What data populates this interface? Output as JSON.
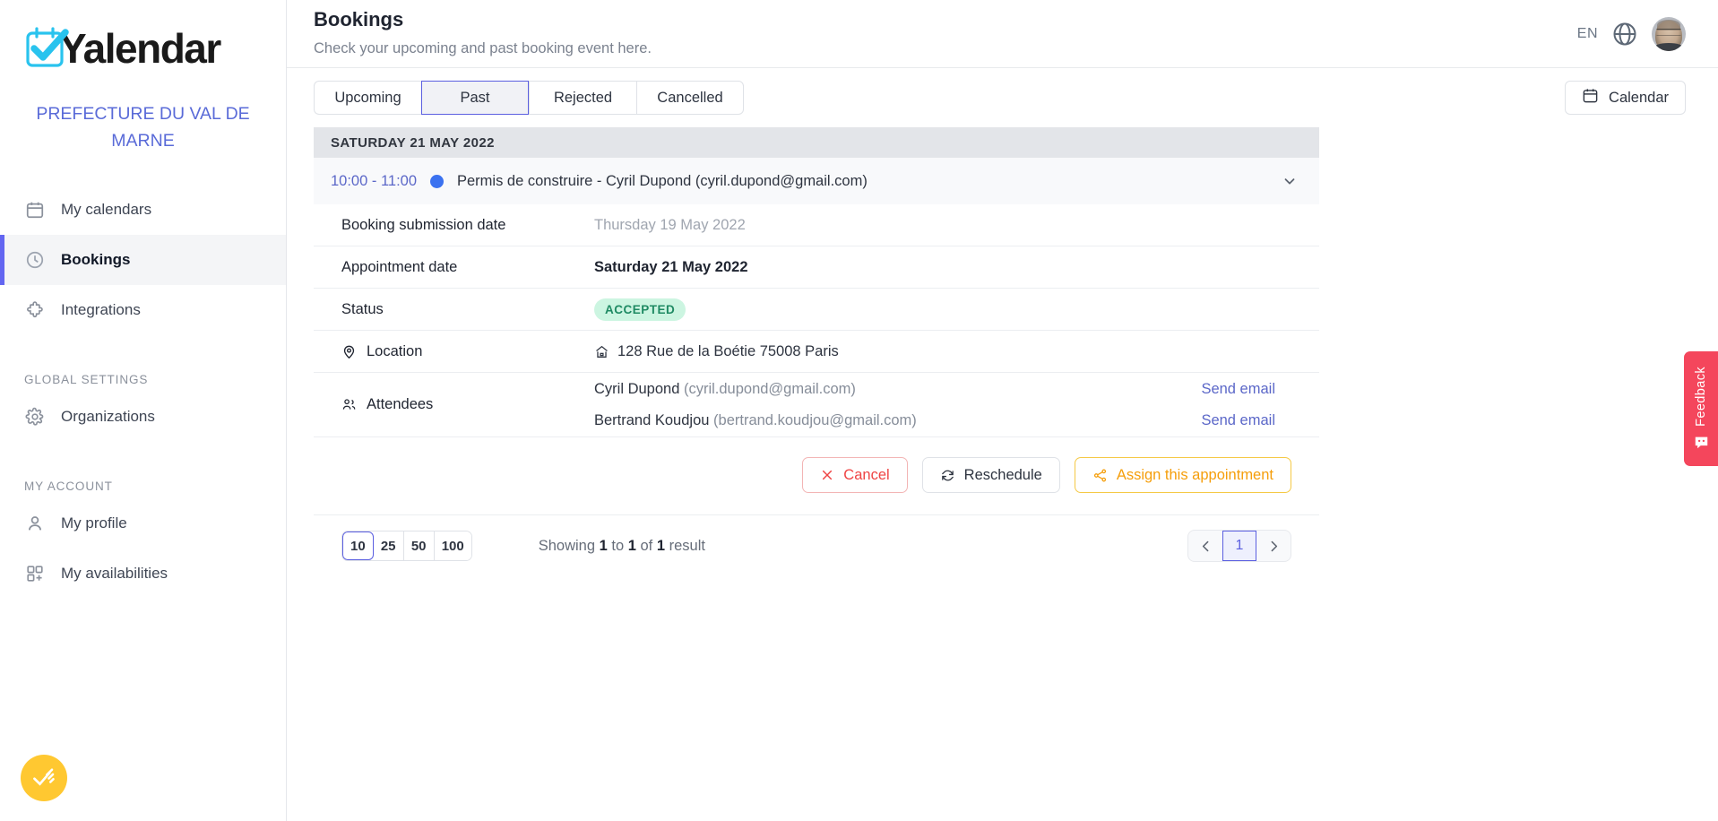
{
  "brand": {
    "logo_text": "Yalendar",
    "logo_icon": "calendar-check-icon"
  },
  "organization": {
    "name": "PREFECTURE DU VAL DE MARNE"
  },
  "sidebar": {
    "items": [
      {
        "label": "My calendars",
        "icon": "calendar-icon",
        "active": false
      },
      {
        "label": "Bookings",
        "icon": "clock-icon",
        "active": true
      },
      {
        "label": "Integrations",
        "icon": "puzzle-icon",
        "active": false
      }
    ],
    "global_settings_label": "GLOBAL SETTINGS",
    "global_settings_items": [
      {
        "label": "Organizations",
        "icon": "gear-icon"
      }
    ],
    "my_account_label": "MY ACCOUNT",
    "my_account_items": [
      {
        "label": "My profile",
        "icon": "user-icon"
      },
      {
        "label": "My availabilities",
        "icon": "grid-plus-icon"
      }
    ]
  },
  "header": {
    "title": "Bookings",
    "subtitle": "Check your upcoming and past booking event here.",
    "language": "EN",
    "globe_icon": "globe-icon",
    "avatar": "user-avatar"
  },
  "tabs": [
    {
      "label": "Upcoming",
      "active": false
    },
    {
      "label": "Past",
      "active": true
    },
    {
      "label": "Rejected",
      "active": false
    },
    {
      "label": "Cancelled",
      "active": false
    }
  ],
  "calendar_button": {
    "label": "Calendar",
    "icon": "calendar-icon"
  },
  "day_group": {
    "header": "SATURDAY 21 MAY 2022"
  },
  "booking": {
    "time": "10:00 - 11:00",
    "dot_color": "#3b72f0",
    "title": "Permis de construire - Cyril Dupond (cyril.dupond@gmail.com)",
    "expand_icon": "chevron-down-icon"
  },
  "details": {
    "submission_label": "Booking submission date",
    "submission_value": "Thursday 19 May 2022",
    "appointment_label": "Appointment date",
    "appointment_value": "Saturday 21 May 2022",
    "status_label": "Status",
    "status_value": "ACCEPTED",
    "status_bg": "#ccf5e1",
    "status_color": "#1f8a63",
    "location_label": "Location",
    "location_value": "128 Rue de la Boétie 75008 Paris",
    "attendees_label": "Attendees",
    "attendees": [
      {
        "name": "Cyril Dupond",
        "email": "(cyril.dupond@gmail.com)",
        "action": "Send email"
      },
      {
        "name": "Bertrand Koudjou",
        "email": "(bertrand.koudjou@gmail.com)",
        "action": "Send email"
      }
    ]
  },
  "actions": {
    "cancel": "Cancel",
    "reschedule": "Reschedule",
    "assign": "Assign this appointment"
  },
  "pagination": {
    "sizes": [
      "10",
      "25",
      "50",
      "100"
    ],
    "active_size": "10",
    "showing_prefix": "Showing ",
    "showing_from": "1",
    "showing_mid": " to ",
    "showing_to": "1",
    "showing_of": " of ",
    "showing_total": "1",
    "showing_suffix": " result",
    "prev_icon": "chevron-left-icon",
    "page": "1",
    "next_icon": "chevron-right-icon"
  },
  "feedback": {
    "label": "Feedback",
    "color": "#f4465c",
    "icon": "smiley-chat-icon"
  },
  "floating_button": {
    "icon": "check-swoosh-icon",
    "color": "#ffc831"
  }
}
